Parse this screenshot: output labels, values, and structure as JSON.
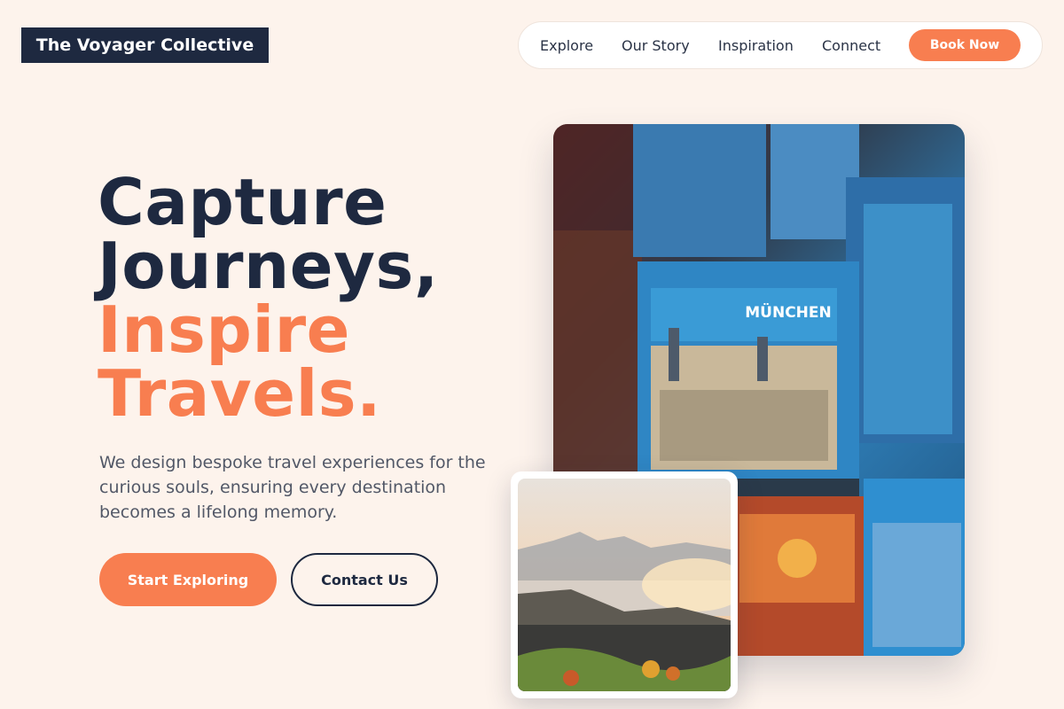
{
  "brand": {
    "name": "The Voyager Collective"
  },
  "nav": {
    "links": [
      "Explore",
      "Our Story",
      "Inspiration",
      "Connect"
    ],
    "cta": "Book Now"
  },
  "hero": {
    "headline_dark": [
      "Capture",
      "Journeys,"
    ],
    "headline_accent": [
      "Inspire",
      "Travels."
    ],
    "description": "We design bespoke travel experiences for the curious souls, ensuring every destination becomes a lifelong memory.",
    "primary_button": "Start Exploring",
    "secondary_button": "Contact Us",
    "main_image_caption": "MÜNCHEN"
  },
  "colors": {
    "background": "#fdf3ec",
    "navy": "#1e2940",
    "accent": "#f87e50"
  }
}
